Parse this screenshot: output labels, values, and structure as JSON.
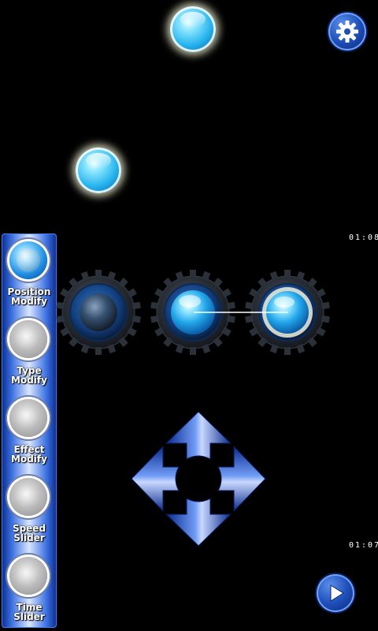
{
  "settings": {
    "icon": "gear-icon"
  },
  "timestamps": {
    "top": "01:08",
    "bottom": "01:07"
  },
  "side_panel": {
    "items": [
      {
        "label_line1": "Position",
        "label_line2": "Modify",
        "active": true
      },
      {
        "label_line1": "Type",
        "label_line2": "Modify",
        "active": false
      },
      {
        "label_line1": "Effect",
        "label_line2": "Modify",
        "active": false
      },
      {
        "label_line1": "Speed",
        "label_line2": "Slider",
        "active": false
      },
      {
        "label_line1": "Time",
        "label_line2": "Slider",
        "active": false
      }
    ]
  },
  "gears": [
    {
      "state": "dim"
    },
    {
      "state": "lit"
    },
    {
      "state": "glow"
    }
  ],
  "dpad": {
    "directions": [
      "up",
      "down",
      "left",
      "right"
    ]
  },
  "play": {
    "icon": "play-icon"
  },
  "colors": {
    "accent": "#1e4fb8",
    "orb": "#29b6ee",
    "background": "#000000"
  }
}
